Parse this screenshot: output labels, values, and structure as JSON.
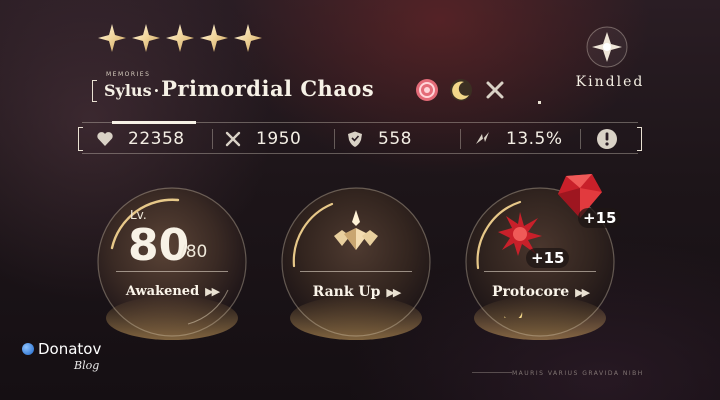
{
  "header": {
    "stars_count": 5,
    "memories_tag": "MEMORIES",
    "character": "Sylus",
    "separator": "·",
    "card_title": "Primordial Chaos",
    "type_icons": [
      "solar-pink-icon",
      "moon-icon",
      "crossed-blades-icon"
    ]
  },
  "status": {
    "icon": "kindled-crystal-icon",
    "label": "Kindled"
  },
  "stats": [
    {
      "icon": "hp-heart-icon",
      "value": "22358"
    },
    {
      "icon": "attack-swords-icon",
      "value": "1950"
    },
    {
      "icon": "defense-shield-icon",
      "value": "558"
    },
    {
      "icon": "crit-rate-icon",
      "value": "13.5%"
    }
  ],
  "info_icon": "info-exclamation-icon",
  "orbs": {
    "awakened": {
      "lv_label": "Lv.",
      "level": "80",
      "max": "/80",
      "label": "Awakened",
      "arrows": "▶▶"
    },
    "rank_up": {
      "label": "Rank Up",
      "arrows": "▶▶",
      "icon": "rank-crystal-icon"
    },
    "protocore": {
      "label": "Protocore",
      "arrows": "▶▶",
      "top_plus": "+15",
      "bottom_plus": "+15"
    }
  },
  "footer": {
    "motto": "MAURIS VARIUS GRAVIDA NIBH"
  },
  "watermark": {
    "brand": "Donatov",
    "sub": "Blog"
  },
  "colors": {
    "accent_gold": "#d6a862",
    "text_light": "#f3eee4",
    "gem_red": "#c8202a"
  }
}
